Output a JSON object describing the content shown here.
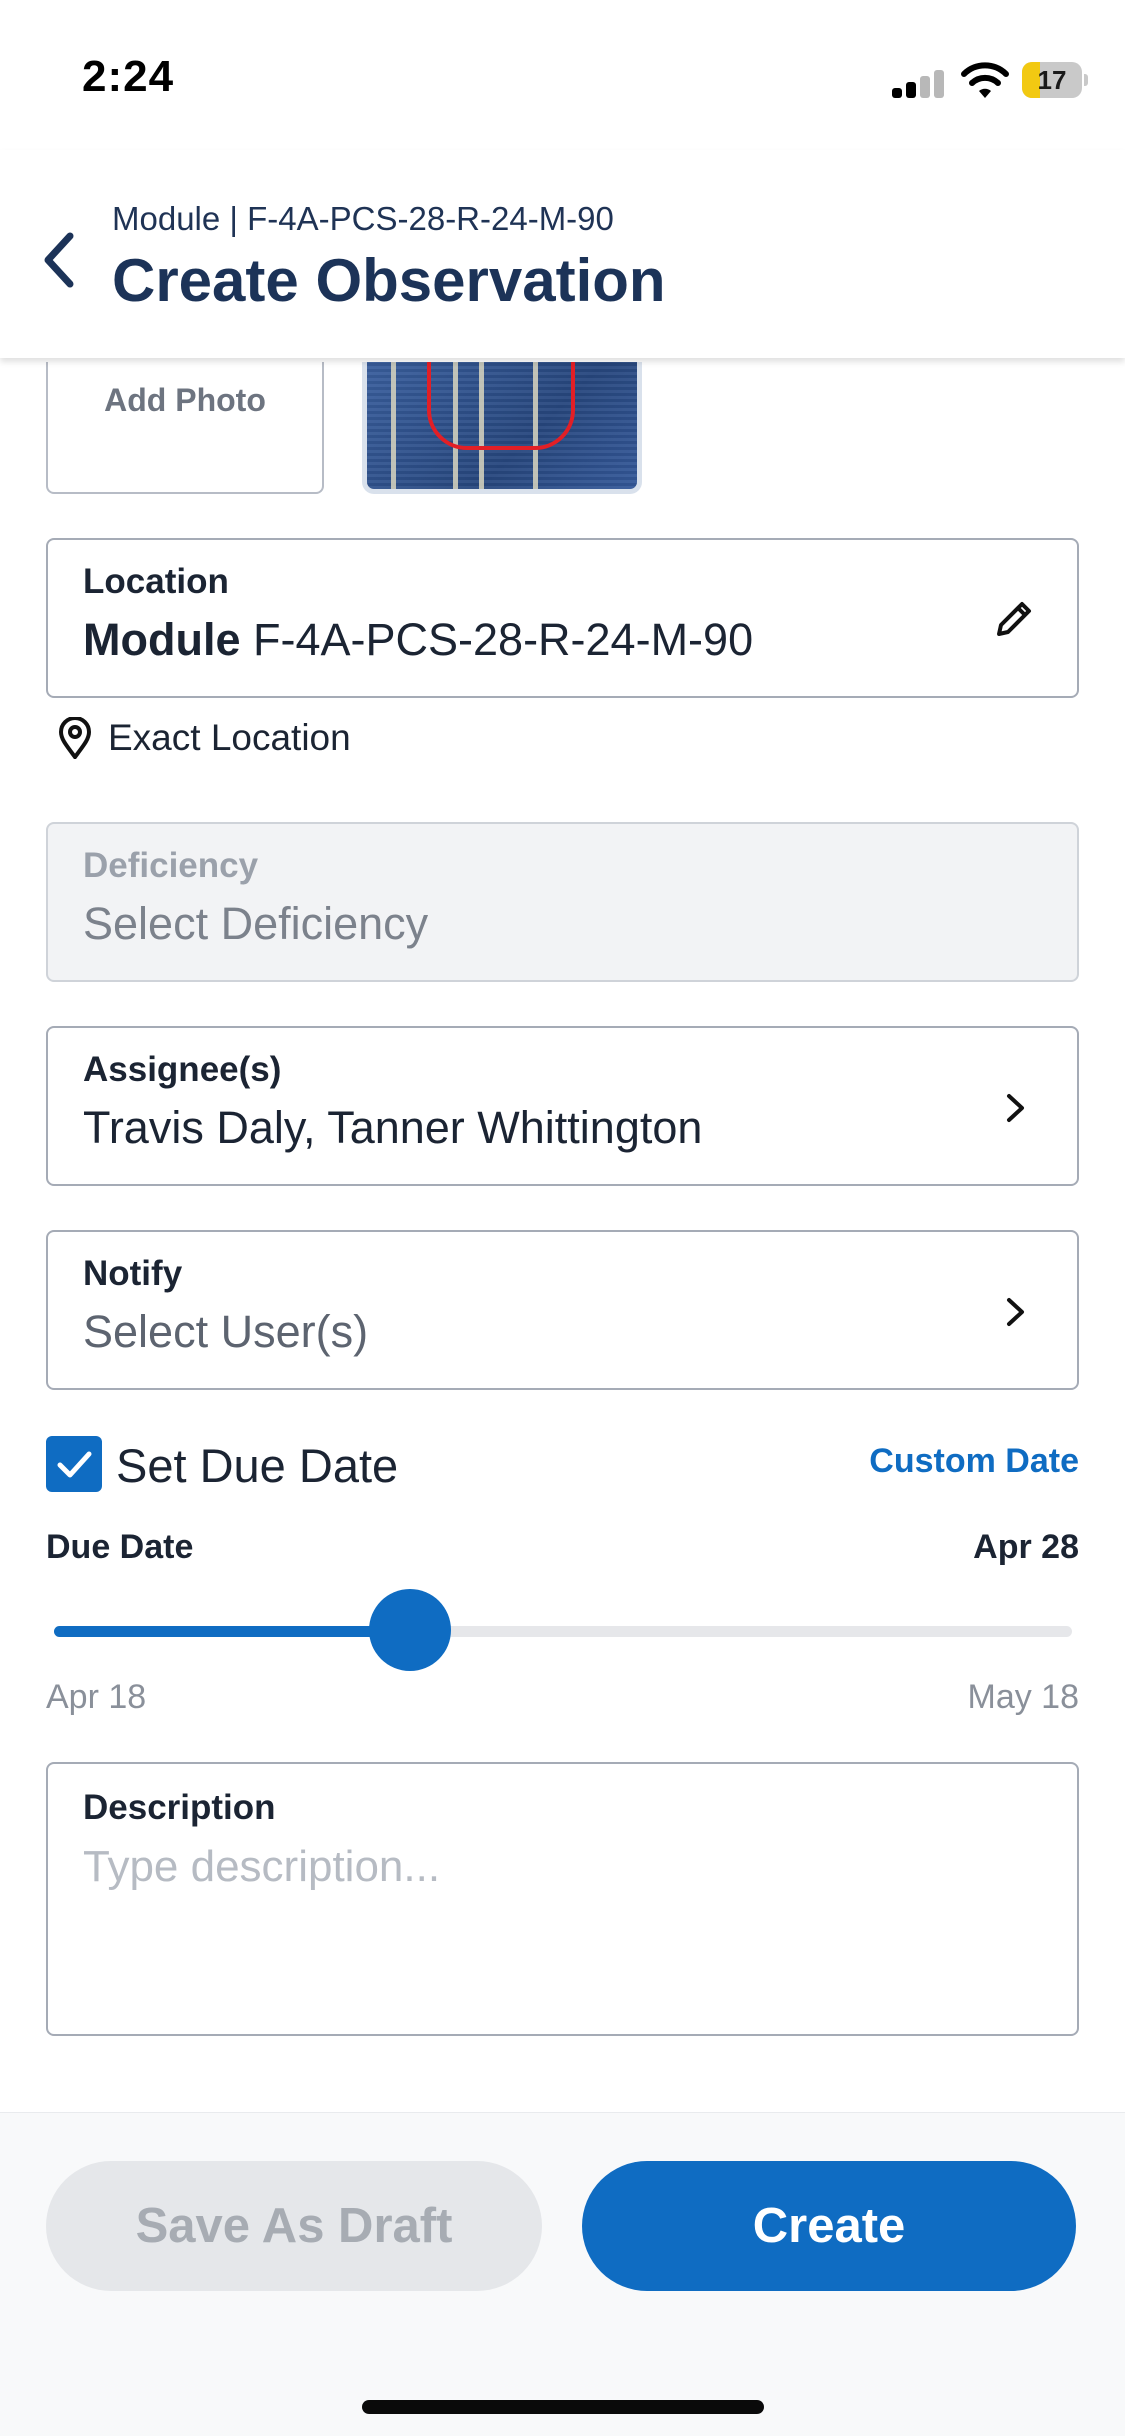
{
  "status_bar": {
    "time": "2:24",
    "battery_level": "17",
    "icons": [
      "cellular-signal-icon",
      "wifi-icon",
      "battery-icon"
    ]
  },
  "header": {
    "subtitle": "Module | F-4A-PCS-28-R-24-M-90",
    "title": "Create Observation",
    "back_icon": "chevron-left-icon"
  },
  "photos": {
    "add_photo_label": "Add Photo"
  },
  "location": {
    "label": "Location",
    "value_prefix": "Module",
    "value": "F-4A-PCS-28-R-24-M-90",
    "exact_location_label": "Exact Location"
  },
  "deficiency": {
    "label": "Deficiency",
    "placeholder": "Select Deficiency"
  },
  "assignees": {
    "label": "Assignee(s)",
    "value": "Travis Daly, Tanner Whittington"
  },
  "notify": {
    "label": "Notify",
    "placeholder": "Select User(s)"
  },
  "due_date": {
    "checkbox_label": "Set Due Date",
    "checked": true,
    "custom_date_label": "Custom Date",
    "label": "Due Date",
    "value": "Apr 28",
    "slider_min": "Apr 18",
    "slider_max": "May 18",
    "slider_fraction": 0.35
  },
  "description": {
    "label": "Description",
    "placeholder": "Type description..."
  },
  "actions": {
    "save_draft_label": "Save As Draft",
    "create_label": "Create"
  },
  "colors": {
    "accent": "#0f6cc2",
    "title": "#1c3358",
    "battery": "#f2c912"
  }
}
